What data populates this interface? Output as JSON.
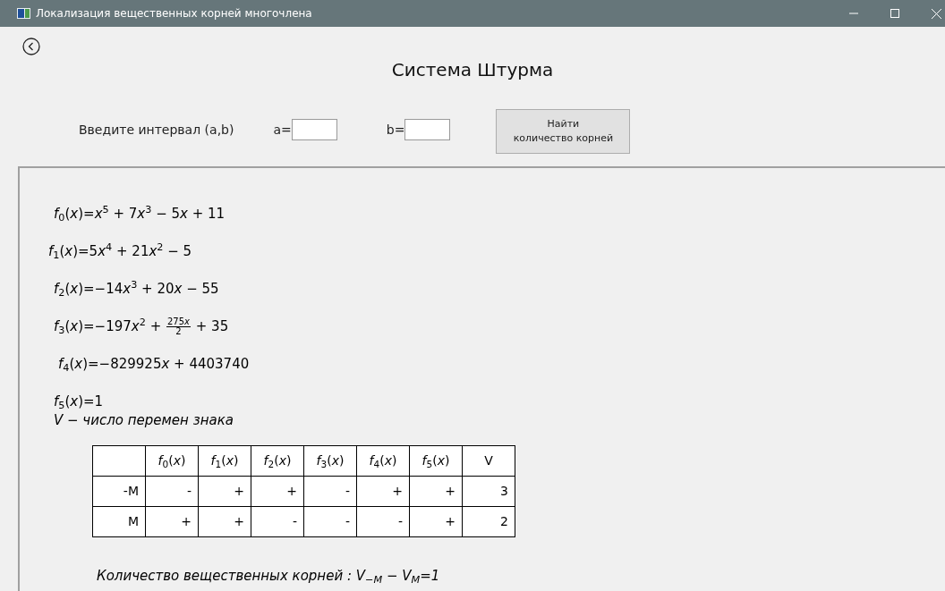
{
  "window": {
    "title": "Локализация вещественных корней многочлена"
  },
  "header": {
    "title": "Система Штурма"
  },
  "interval": {
    "label": "Введите интервал (a,b)",
    "a_label": "a=",
    "b_label": "b=",
    "button_lines": [
      "Найти",
      "количество корней"
    ]
  },
  "formulas": [
    {
      "parts": [
        {
          "kind": "text",
          "text": "*f*$_{0}$(*x*)=*x*$^{5}$ + 7"
        },
        {
          "kind": "text",
          "text": "*x*$^{3}$ − 5"
        },
        {
          "kind": "text",
          "text": "*x* + 11"
        }
      ]
    },
    {
      "parts": [
        {
          "kind": "text",
          "text": "*f*$_{1}$(*x*)=5"
        },
        {
          "kind": "text",
          "text": "*x*$^{4}$ + 21"
        },
        {
          "kind": "text",
          "text": "*x*$^{2}$ − 5"
        }
      ]
    },
    {
      "parts": [
        {
          "kind": "text",
          "text": "*f*$_{2}$(*x*)=−14"
        },
        {
          "kind": "text",
          "text": "*x*$^{3}$ + 20"
        },
        {
          "kind": "text",
          "text": "*x* − 55"
        }
      ]
    },
    {
      "parts": [
        {
          "kind": "text",
          "text": "*f*$_{3}$(*x*)=−197"
        },
        {
          "kind": "text",
          "text": "*x*$^{2}$ + "
        },
        {
          "kind": "fraction",
          "numerator": [
            "275",
            "*x*"
          ],
          "denominator": "2"
        },
        {
          "kind": "text",
          "text": " + 35"
        }
      ]
    },
    {
      "parts": [
        {
          "kind": "text",
          "text": "*f*$_{4}$(*x*)=−829925"
        },
        {
          "kind": "text",
          "text": "*x* + 4403740"
        }
      ]
    },
    {
      "parts": [
        {
          "kind": "text",
          "text": "*f*$_{5}$(*x*)=1"
        }
      ]
    }
  ],
  "legend": "V − число перемен знака",
  "table": {
    "columns": [
      "",
      "*f*$_{0}$(*x*)",
      "*f*$_{1}$(*x*)",
      "*f*$_{2}$(*x*)",
      "*f*$_{3}$(*x*)",
      "*f*$_{4}$(*x*)",
      "*f*$_{5}$(*x*)",
      "V"
    ],
    "rows": [
      [
        "-M",
        "-",
        "+",
        "+",
        "-",
        "+",
        "+",
        "3"
      ],
      [
        "M",
        "+",
        "+",
        "-",
        "-",
        "-",
        "+",
        "2"
      ]
    ]
  },
  "result": "Количество вещественных корней :  V$_{−M}$ − V$_{M}$=1"
}
